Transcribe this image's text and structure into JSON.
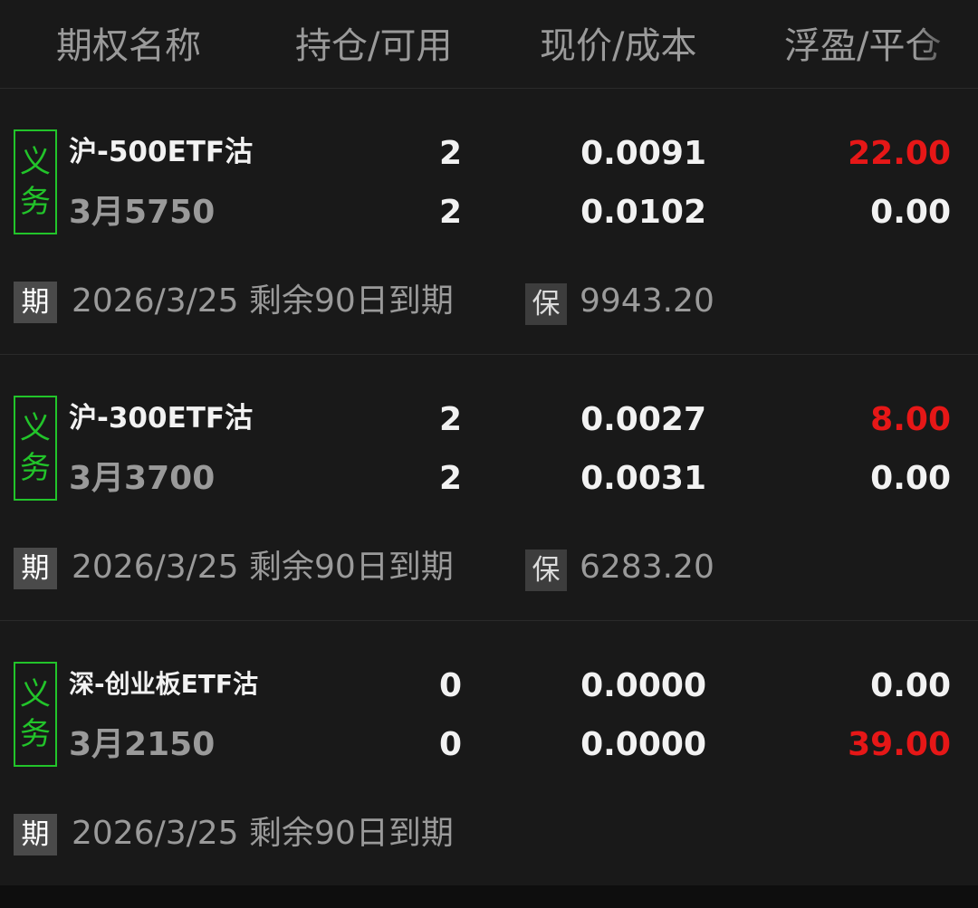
{
  "header": {
    "col_name": "期权名称",
    "col_position": "持仓/可用",
    "col_price": "现价/成本",
    "col_pnl": "浮盈/平仓"
  },
  "positions": [
    {
      "type_top": "义",
      "type_bottom": "务",
      "name": "沪-500ETF沽",
      "strike": "3月5750",
      "position": "2",
      "available": "2",
      "price": "0.0091",
      "cost": "0.0102",
      "floating_pnl": "22.00",
      "close_pnl": "0.00",
      "expiry_label": "期",
      "expiry_text": "2026/3/25 剩余90日到期",
      "margin_label": "保",
      "margin_value": "9943.20"
    },
    {
      "type_top": "义",
      "type_bottom": "务",
      "name": "沪-300ETF沽",
      "strike": "3月3700",
      "position": "2",
      "available": "2",
      "price": "0.0027",
      "cost": "0.0031",
      "floating_pnl": "8.00",
      "close_pnl": "0.00",
      "expiry_label": "期",
      "expiry_text": "2026/3/25 剩余90日到期",
      "margin_label": "保",
      "margin_value": "6283.20"
    },
    {
      "type_top": "义",
      "type_bottom": "务",
      "name": "深-创业板ETF沽",
      "strike": "3月2150",
      "position": "0",
      "available": "0",
      "price": "0.0000",
      "cost": "0.0000",
      "floating_pnl": "0.00",
      "close_pnl": "39.00",
      "expiry_label": "期",
      "expiry_text": "2026/3/25 剩余90日到期"
    }
  ],
  "colors": {
    "background": "#191919",
    "text_primary": "#f2f2f2",
    "text_secondary": "#9a9a9a",
    "profit_red": "#e61717",
    "badge_green": "#22c42a"
  }
}
